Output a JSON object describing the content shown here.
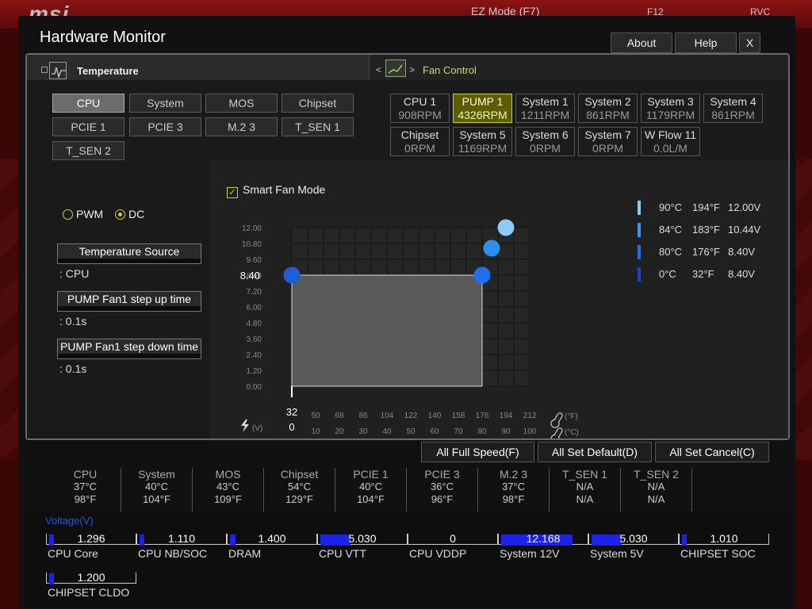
{
  "background": {
    "brand": "msi",
    "ez_mode": "EZ Mode (F7)",
    "f12": "F12",
    "lang": "RVC"
  },
  "window": {
    "title": "Hardware Monitor",
    "about": "About",
    "help": "Help",
    "close": "X"
  },
  "tabs": {
    "temperature": "Temperature",
    "fan_control": "Fan Control"
  },
  "sources": [
    "CPU",
    "System",
    "MOS",
    "Chipset",
    "PCIE 1",
    "PCIE 3",
    "M.2 3",
    "T_SEN 1",
    "T_SEN 2"
  ],
  "selected_source": "CPU",
  "fans": [
    {
      "name": "CPU 1",
      "rpm": "908RPM"
    },
    {
      "name": "PUMP 1",
      "rpm": "4326RPM"
    },
    {
      "name": "System 1",
      "rpm": "1211RPM"
    },
    {
      "name": "System 2",
      "rpm": "861RPM"
    },
    {
      "name": "System 3",
      "rpm": "1179RPM"
    },
    {
      "name": "System 4",
      "rpm": "861RPM"
    },
    {
      "name": "Chipset",
      "rpm": "0RPM"
    },
    {
      "name": "System 5",
      "rpm": "1169RPM"
    },
    {
      "name": "System 6",
      "rpm": "0RPM"
    },
    {
      "name": "System 7",
      "rpm": "0RPM"
    },
    {
      "name": "W Flow 11",
      "rpm": "0.0L/M"
    }
  ],
  "selected_fan": "PUMP 1",
  "mode": {
    "pwm": "PWM",
    "dc": "DC",
    "selected": "DC"
  },
  "temp_source": {
    "label": "Temperature Source",
    "value": ": CPU"
  },
  "step_up": {
    "label": "PUMP Fan1 step up time",
    "value": ": 0.1s"
  },
  "step_down": {
    "label": "PUMP Fan1 step down time",
    "value": ": 0.1s"
  },
  "smart_fan_mode": "Smart Fan Mode",
  "chart_data": {
    "type": "line",
    "y_ticks": [
      "12.00",
      "10.80",
      "9.60",
      "8.40",
      "7.20",
      "6.00",
      "4.80",
      "3.60",
      "2.40",
      "1.20",
      "0.00"
    ],
    "x_ticks_f": [
      "32",
      "50",
      "68",
      "86",
      "104",
      "122",
      "140",
      "158",
      "176",
      "194",
      "212"
    ],
    "x_ticks_c": [
      "0",
      "10",
      "20",
      "30",
      "40",
      "50",
      "60",
      "70",
      "80",
      "90",
      "100"
    ],
    "highlight_y": "8.40",
    "y_unit": "(V)",
    "unit_f": "(°F)",
    "unit_c": "(°C)",
    "ylim": [
      0,
      12
    ],
    "xlim": [
      0,
      100
    ],
    "points": [
      {
        "temp_c": 0,
        "volt": 8.4,
        "color": "#1f5fd6"
      },
      {
        "temp_c": 80,
        "volt": 8.4,
        "color": "#1f6ff0"
      },
      {
        "temp_c": 84,
        "volt": 10.44,
        "color": "#2a8ef0"
      },
      {
        "temp_c": 90,
        "volt": 12.0,
        "color": "#8ccbf6"
      }
    ]
  },
  "legend": [
    {
      "c": "90°C",
      "f": "194°F",
      "v": "12.00V",
      "color": "#8ccbf6"
    },
    {
      "c": "84°C",
      "f": "183°F",
      "v": "10.44V",
      "color": "#3a98f0"
    },
    {
      "c": "80°C",
      "f": "176°F",
      "v": "8.40V",
      "color": "#1f6ff0"
    },
    {
      "c": "0°C",
      "f": "32°F",
      "v": "8.40V",
      "color": "#1f3fd0"
    }
  ],
  "actions": {
    "full_speed": "All Full Speed(F)",
    "set_default": "All Set Default(D)",
    "set_cancel": "All Set Cancel(C)"
  },
  "temperatures": [
    {
      "name": "CPU",
      "c": "37°C",
      "f": "98°F"
    },
    {
      "name": "System",
      "c": "40°C",
      "f": "104°F"
    },
    {
      "name": "MOS",
      "c": "43°C",
      "f": "109°F"
    },
    {
      "name": "Chipset",
      "c": "54°C",
      "f": "129°F"
    },
    {
      "name": "PCIE 1",
      "c": "40°C",
      "f": "104°F"
    },
    {
      "name": "PCIE 3",
      "c": "36°C",
      "f": "96°F"
    },
    {
      "name": "M.2 3",
      "c": "37°C",
      "f": "98°F"
    },
    {
      "name": "T_SEN 1",
      "c": "N/A",
      "f": "N/A"
    },
    {
      "name": "T_SEN 2",
      "c": "N/A",
      "f": "N/A"
    }
  ],
  "voltage_title": "Voltage(V)",
  "voltages": [
    {
      "name": "CPU Core",
      "value": "1.296",
      "level": 0.06
    },
    {
      "name": "CPU NB/SOC",
      "value": "1.110",
      "level": 0.05
    },
    {
      "name": "DRAM",
      "value": "1.400",
      "level": 0.07
    },
    {
      "name": "CPU VTT",
      "value": "5.030",
      "level": 0.36
    },
    {
      "name": "CPU VDDP",
      "value": "0",
      "level": 0
    },
    {
      "name": "System 12V",
      "value": "12.168",
      "level": 0.85
    },
    {
      "name": "System 5V",
      "value": "5.030",
      "level": 0.36
    },
    {
      "name": "CHIPSET SOC",
      "value": "1.010",
      "level": 0.05
    },
    {
      "name": "CHIPSET CLDO",
      "value": "1.200",
      "level": 0.05
    }
  ]
}
